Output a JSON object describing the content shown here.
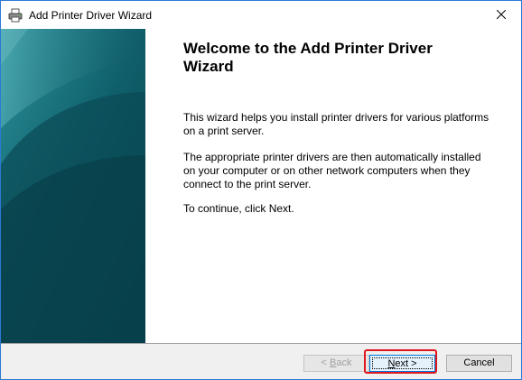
{
  "window": {
    "title": "Add Printer Driver Wizard",
    "title_icon": "printer-icon",
    "close_icon": "close-icon"
  },
  "main": {
    "heading": "Welcome to the Add Printer Driver Wizard",
    "paragraphs": [
      "This wizard helps you install printer drivers for various platforms on a print server.",
      "The appropriate printer drivers are then automatically installed on your computer or on other network computers when they connect to the print server.",
      "To continue, click Next."
    ]
  },
  "buttons": {
    "back": {
      "prefix": "< ",
      "mnemonic": "B",
      "rest": "ack"
    },
    "next": {
      "prefix": "",
      "mnemonic": "N",
      "rest": "ext >"
    },
    "cancel": "Cancel"
  },
  "colors": {
    "banner_dark": "#0b4a55",
    "banner_light": "#1f8a96",
    "highlight": "#e0181e",
    "focus_border": "#0078d7"
  }
}
